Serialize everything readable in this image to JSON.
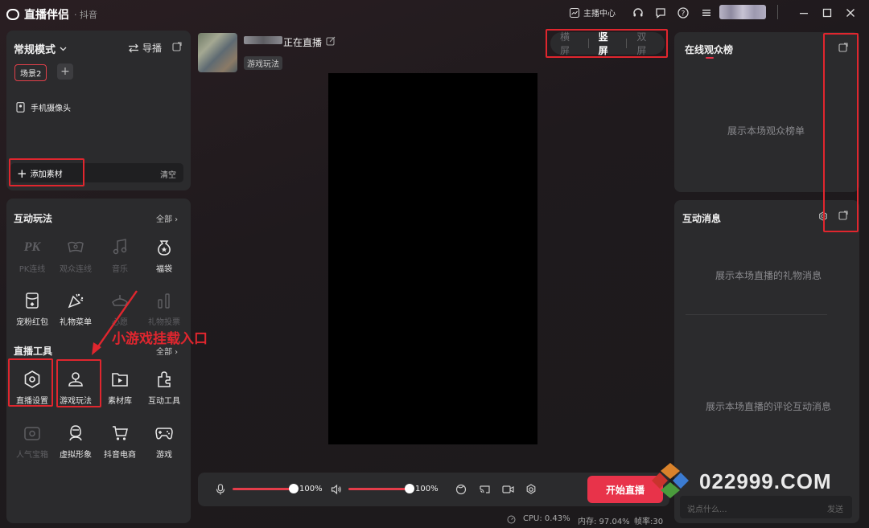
{
  "titlebar": {
    "app_name": "直播伴侣",
    "app_sub": "· 抖音",
    "creator_center": "主播中心"
  },
  "left_top": {
    "mode": "常规模式",
    "guide": "导播",
    "scene_tag": "场景2",
    "source_item": "手机摄像头",
    "add_material": "添加素材",
    "clear": "清空"
  },
  "interactive": {
    "title": "互动玩法",
    "all": "全部 ›",
    "items": [
      {
        "label": "PK连线",
        "icon": "pk-icon",
        "enabled": false
      },
      {
        "label": "观众连线",
        "icon": "audience-link-icon",
        "enabled": false
      },
      {
        "label": "音乐",
        "icon": "music-icon",
        "enabled": false
      },
      {
        "label": "福袋",
        "icon": "lucky-bag-icon",
        "enabled": true
      },
      {
        "label": "宠粉红包",
        "icon": "red-packet-icon",
        "enabled": true
      },
      {
        "label": "礼物菜单",
        "icon": "gift-menu-icon",
        "enabled": true
      },
      {
        "label": "心愿",
        "icon": "wish-icon",
        "enabled": false
      },
      {
        "label": "礼物投票",
        "icon": "gift-vote-icon",
        "enabled": false
      }
    ]
  },
  "tools": {
    "title": "直播工具",
    "all": "全部 ›",
    "items": [
      {
        "label": "直播设置",
        "icon": "live-settings-icon",
        "enabled": true
      },
      {
        "label": "游戏玩法",
        "icon": "game-play-icon",
        "enabled": true
      },
      {
        "label": "素材库",
        "icon": "material-library-icon",
        "enabled": true
      },
      {
        "label": "互动工具",
        "icon": "interactive-tools-icon",
        "enabled": true
      },
      {
        "label": "人气宝箱",
        "icon": "popularity-box-icon",
        "enabled": false
      },
      {
        "label": "虚拟形象",
        "icon": "avatar-icon",
        "enabled": true
      },
      {
        "label": "抖音电商",
        "icon": "ecommerce-icon",
        "enabled": true
      },
      {
        "label": "游戏",
        "icon": "gamepad-icon",
        "enabled": true
      }
    ]
  },
  "annotation": "小游戏挂载入口",
  "stream": {
    "status": "正在直播",
    "category_tag": "游戏玩法"
  },
  "screen_modes": {
    "landscape": "横屏",
    "portrait": "竖屏",
    "dual": "双屏",
    "active": "portrait"
  },
  "audio": {
    "mic_volume": "100%",
    "speaker_volume": "100%",
    "mic_level": 1.0,
    "speaker_level": 1.0
  },
  "start_button": "开始直播",
  "status_bar": {
    "cpu": "CPU: 0.43%",
    "memory": "内存: 97.04%",
    "fps": "帧率:30"
  },
  "right": {
    "ranking_title": "在线观众榜",
    "ranking_placeholder": "展示本场观众榜单",
    "messages_title": "互动消息",
    "gift_placeholder": "展示本场直播的礼物消息",
    "comment_placeholder": "展示本场直播的评论互动消息",
    "chat_placeholder": "说点什么...",
    "send": "发送"
  },
  "watermark": "022999.COM",
  "colors": {
    "accent": "#e8334a",
    "annotation_red": "#e0262e",
    "panel": "#2b2b2d"
  }
}
